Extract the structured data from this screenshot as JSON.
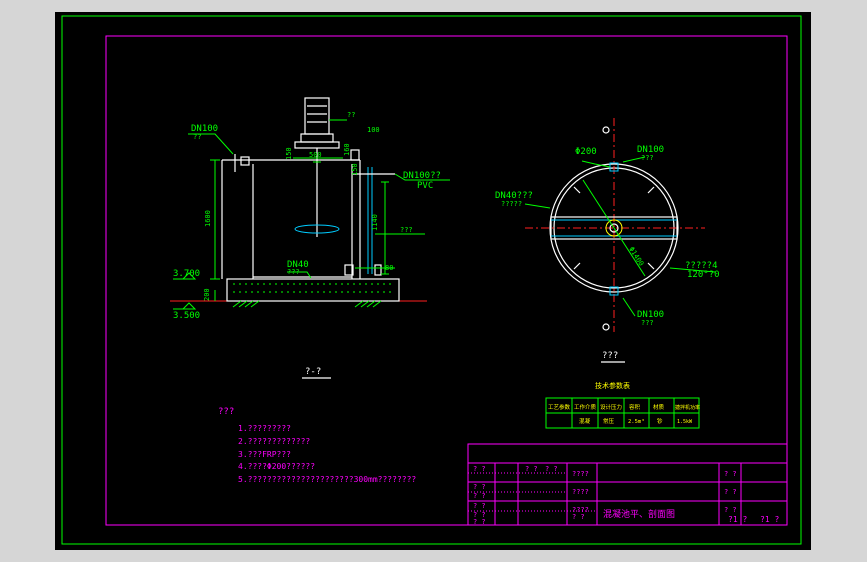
{
  "section_view": {
    "pipe_top_label": "DN100",
    "pipe_top_sub": "??",
    "motor_label": "??",
    "dim_top_right": "100",
    "dim_150": "150",
    "dim_500": "500",
    "dim_160": "160",
    "dim_150b": "150",
    "pvc_label_a": "DN100??",
    "pvc_label_b": "PVC",
    "dim_height": "1600",
    "dim_1140": "1140",
    "ladder_label": "???",
    "dn40_label": "DN40",
    "dn40_sub": "???",
    "dim_80": "80",
    "dim_200": "200",
    "elev_1": "3.700",
    "elev_2": "3.500",
    "title": "?-?"
  },
  "plan_view": {
    "phi200": "Φ200",
    "dn100_top": "DN100",
    "dn100_top_sub": "???",
    "dn40_label": "DN40???",
    "dn40_sub": "?????",
    "phi_diameter": "Φ1400",
    "support_label": "?????4",
    "support_sub": "120°?0",
    "dn100_bottom": "DN100",
    "dn100_bottom_sub": "???",
    "title": "???"
  },
  "spec_table": {
    "caption": "技术参数表",
    "headers": [
      "工艺参数",
      "工作介质",
      "设计压力",
      "容积",
      "材质",
      "搪拌机功率"
    ],
    "values": [
      "",
      "混凝",
      "常压",
      "2.5m³",
      "钞",
      "1.5kW"
    ]
  },
  "notes": {
    "heading": "???",
    "lines": [
      "1.?????????",
      "2.?????????????",
      "3.???FRP???",
      "4.????Φ200??????",
      "5.??????????????????????300mm????????"
    ]
  },
  "title_block": {
    "r1c1": "? ?",
    "r1c2": "? ?",
    "r1c3": "? ?",
    "r1c4": "????",
    "r1c5": "? ?",
    "r2c4": "????",
    "r2c5": "? ?",
    "r3c4": "????",
    "r3c5": "? ?",
    "r4c3": "? ?",
    "drawing_name": "混凝池平、剖面图",
    "r4c5a": "?1 ?",
    "r4c5b": "?1 ?"
  }
}
